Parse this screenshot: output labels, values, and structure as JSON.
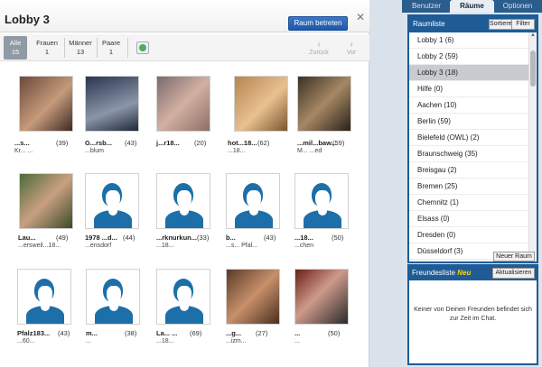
{
  "lobby": {
    "title": "Lobby 3",
    "enter_button": "Raum betreten",
    "close": "✕",
    "filters": [
      {
        "label": "Alle",
        "count": "15"
      },
      {
        "label": "Frauen",
        "count": "1"
      },
      {
        "label": "Männer",
        "count": "13"
      },
      {
        "label": "Paare",
        "count": "1"
      }
    ],
    "back": "Zurück",
    "next": "Vor"
  },
  "users": [
    {
      "name": "...s...",
      "age": "(39)",
      "loc": "Kr... ...",
      "type": "photo"
    },
    {
      "name": "G...rsb...",
      "age": "(43)",
      "loc": "...blum",
      "type": "photo"
    },
    {
      "name": "j...r18...",
      "age": "(20)",
      "loc": "",
      "type": "photo"
    },
    {
      "name": "hot...18...",
      "age": "(62)",
      "loc": "...18...",
      "type": "photo"
    },
    {
      "name": "...mil...baw...",
      "age": "(59)",
      "loc": "M... ...ed",
      "type": "photo"
    },
    {
      "name": "Lau...",
      "age": "(49)",
      "loc": "...ersweil...18...",
      "type": "photo"
    },
    {
      "name": "1978 ...d...",
      "age": "(44)",
      "loc": "...ensdorf",
      "type": "avatar"
    },
    {
      "name": "...rknurkun...",
      "age": "(33)",
      "loc": "...18...",
      "type": "avatar"
    },
    {
      "name": "b...",
      "age": "(43)",
      "loc": "...s... Pfal...",
      "type": "avatar"
    },
    {
      "name": "...18...",
      "age": "(50)",
      "loc": "...chen",
      "type": "avatar"
    },
    {
      "name": "Pfalz183...",
      "age": "(43)",
      "loc": "...60...",
      "type": "avatar"
    },
    {
      "name": "m...",
      "age": "(38)",
      "loc": "...",
      "type": "avatar"
    },
    {
      "name": "La... ...",
      "age": "(69)",
      "loc": "...18...",
      "type": "avatar"
    },
    {
      "name": "...g...",
      "age": "(27)",
      "loc": "...izm...",
      "type": "photo"
    },
    {
      "name": "...",
      "age": "(50)",
      "loc": "...",
      "type": "photo"
    }
  ],
  "right": {
    "tabs": [
      "Benutzer",
      "Räume",
      "Optionen"
    ],
    "rooms_label": "Raumliste",
    "sort_button": "Sortieren▾",
    "filter_button": "Filter",
    "rooms": [
      "Lobby 1 (6)",
      "Lobby 2 (59)",
      "Lobby 3 (18)",
      "Hilfe (0)",
      "Aachen (10)",
      "Berlin (59)",
      "Bielefeld (OWL) (2)",
      "Braunschweig (35)",
      "Breisgau (2)",
      "Bremen (25)",
      "Chemnitz (1)",
      "Elsass (0)",
      "Dresden (0)",
      "Düsseldorf (3)"
    ],
    "new_room_button": "Neuer Raum",
    "friends_label": "Freundesliste",
    "friends_new": "Neu",
    "refresh_button": "Aktualisieren",
    "friends_message": "Keiner von Deinen Freunden befindet sich zur Zeit im Chat."
  }
}
